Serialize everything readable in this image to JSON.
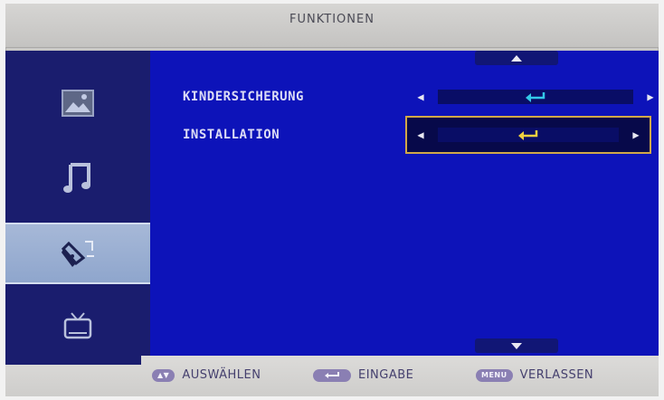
{
  "header": {
    "title": "FUNKTIONEN"
  },
  "sidebar": {
    "items": [
      {
        "icon": "picture-icon",
        "active": false
      },
      {
        "icon": "music-note-icon",
        "active": false
      },
      {
        "icon": "pen-settings-icon",
        "active": true
      },
      {
        "icon": "tv-icon",
        "active": false
      }
    ]
  },
  "menu": {
    "rows": [
      {
        "label": "KINDERSICHERUNG",
        "enter_icon_color": "#33c8e8",
        "selected": false
      },
      {
        "label": "INSTALLATION",
        "enter_icon_color": "#f0d040",
        "selected": true
      }
    ],
    "highlight_color": "#d1a848"
  },
  "footer": {
    "select_key": "▲▼",
    "select_label": "AUSWÄHLEN",
    "enter_label": "EINGABE",
    "menu_key": "MENU",
    "exit_label": "VERLASSEN"
  },
  "colors": {
    "menu_bg": "#0d13b9",
    "sidebar_bg": "#1a1d6e",
    "frame": "#c9c8c6"
  }
}
